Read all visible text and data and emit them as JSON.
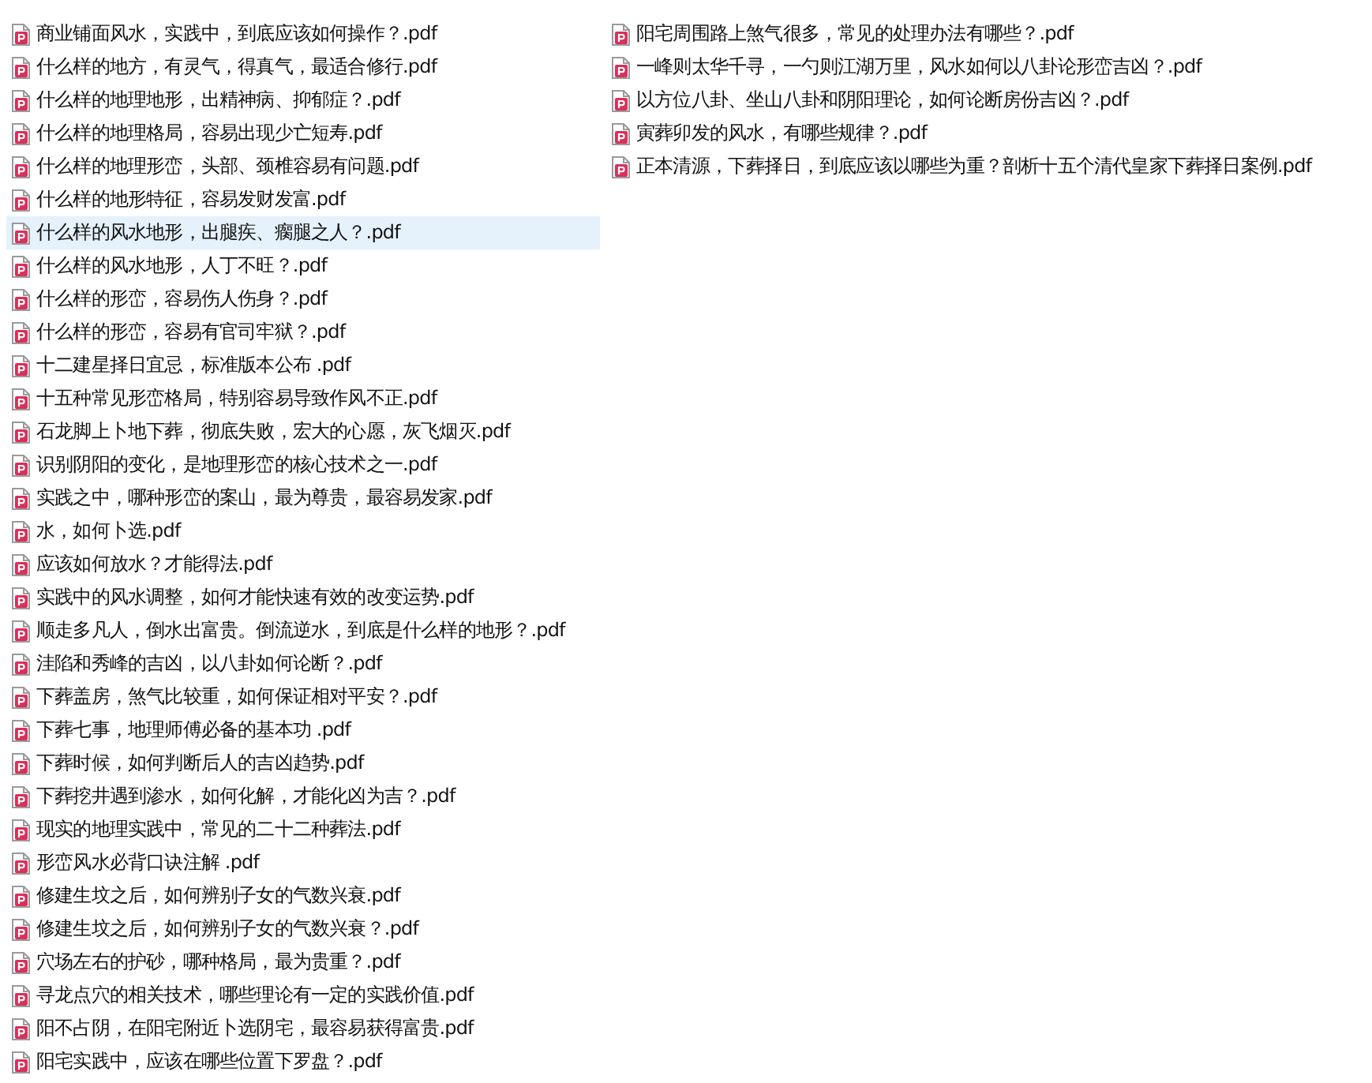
{
  "files": [
    {
      "name": "商业铺面风水，实践中，到底应该如何操作？.pdf",
      "selected": false
    },
    {
      "name": "什么样的地方，有灵气，得真气，最适合修行.pdf",
      "selected": false
    },
    {
      "name": "什么样的地理地形，出精神病、抑郁症？.pdf",
      "selected": false
    },
    {
      "name": "什么样的地理格局，容易出现少亡短寿.pdf",
      "selected": false
    },
    {
      "name": "什么样的地理形峦，头部、颈椎容易有问题.pdf",
      "selected": false
    },
    {
      "name": "什么样的地形特征，容易发财发富.pdf",
      "selected": false
    },
    {
      "name": "什么样的风水地形，出腿疾、瘸腿之人？.pdf",
      "selected": true
    },
    {
      "name": "什么样的风水地形，人丁不旺？.pdf",
      "selected": false
    },
    {
      "name": "什么样的形峦，容易伤人伤身？.pdf",
      "selected": false
    },
    {
      "name": "什么样的形峦，容易有官司牢狱？.pdf",
      "selected": false
    },
    {
      "name": "十二建星择日宜忌，标准版本公布 .pdf",
      "selected": false
    },
    {
      "name": "十五种常见形峦格局，特别容易导致作风不正.pdf",
      "selected": false
    },
    {
      "name": "石龙脚上卜地下葬，彻底失败，宏大的心愿，灰飞烟灭.pdf",
      "selected": false
    },
    {
      "name": "识别阴阳的变化，是地理形峦的核心技术之一.pdf",
      "selected": false
    },
    {
      "name": "实践之中，哪种形峦的案山，最为尊贵，最容易发家.pdf",
      "selected": false
    },
    {
      "name": "水，如何卜选.pdf",
      "selected": false
    },
    {
      "name": "应该如何放水？才能得法.pdf",
      "selected": false
    },
    {
      "name": "实践中的风水调整，如何才能快速有效的改变运势.pdf",
      "selected": false
    },
    {
      "name": "顺走多凡人，倒水出富贵。倒流逆水，到底是什么样的地形？.pdf",
      "selected": false
    },
    {
      "name": "洼陷和秀峰的吉凶，以八卦如何论断？.pdf",
      "selected": false
    },
    {
      "name": "下葬盖房，煞气比较重，如何保证相对平安？.pdf",
      "selected": false
    },
    {
      "name": "下葬七事，地理师傅必备的基本功 .pdf",
      "selected": false
    },
    {
      "name": "下葬时候，如何判断后人的吉凶趋势.pdf",
      "selected": false
    },
    {
      "name": "下葬挖井遇到渗水，如何化解，才能化凶为吉？.pdf",
      "selected": false
    },
    {
      "name": "现实的地理实践中，常见的二十二种葬法.pdf",
      "selected": false
    },
    {
      "name": "形峦风水必背口诀注解 .pdf",
      "selected": false
    },
    {
      "name": "修建生坟之后，如何辨别子女的气数兴衰.pdf",
      "selected": false
    },
    {
      "name": "修建生坟之后，如何辨别子女的气数兴衰？.pdf",
      "selected": false
    },
    {
      "name": "穴场左右的护砂，哪种格局，最为贵重？.pdf",
      "selected": false
    },
    {
      "name": "寻龙点穴的相关技术，哪些理论有一定的实践价值.pdf",
      "selected": false
    },
    {
      "name": "阳不占阴，在阳宅附近卜选阴宅，最容易获得富贵.pdf",
      "selected": false
    },
    {
      "name": "阳宅实践中，应该在哪些位置下罗盘？.pdf",
      "selected": false
    },
    {
      "name": "阳宅周围路上煞气很多，常见的处理办法有哪些？.pdf",
      "selected": false
    },
    {
      "name": "一峰则太华千寻，一勺则江湖万里，风水如何以八卦论形峦吉凶？.pdf",
      "selected": false
    },
    {
      "name": "以方位八卦、坐山八卦和阴阳理论，如何论断房份吉凶？.pdf",
      "selected": false
    },
    {
      "name": "寅葬卯发的风水，有哪些规律？.pdf",
      "selected": false
    },
    {
      "name": "正本清源，下葬择日，到底应该以哪些为重？剖析十五个清代皇家下葬择日案例.pdf",
      "selected": false
    }
  ]
}
